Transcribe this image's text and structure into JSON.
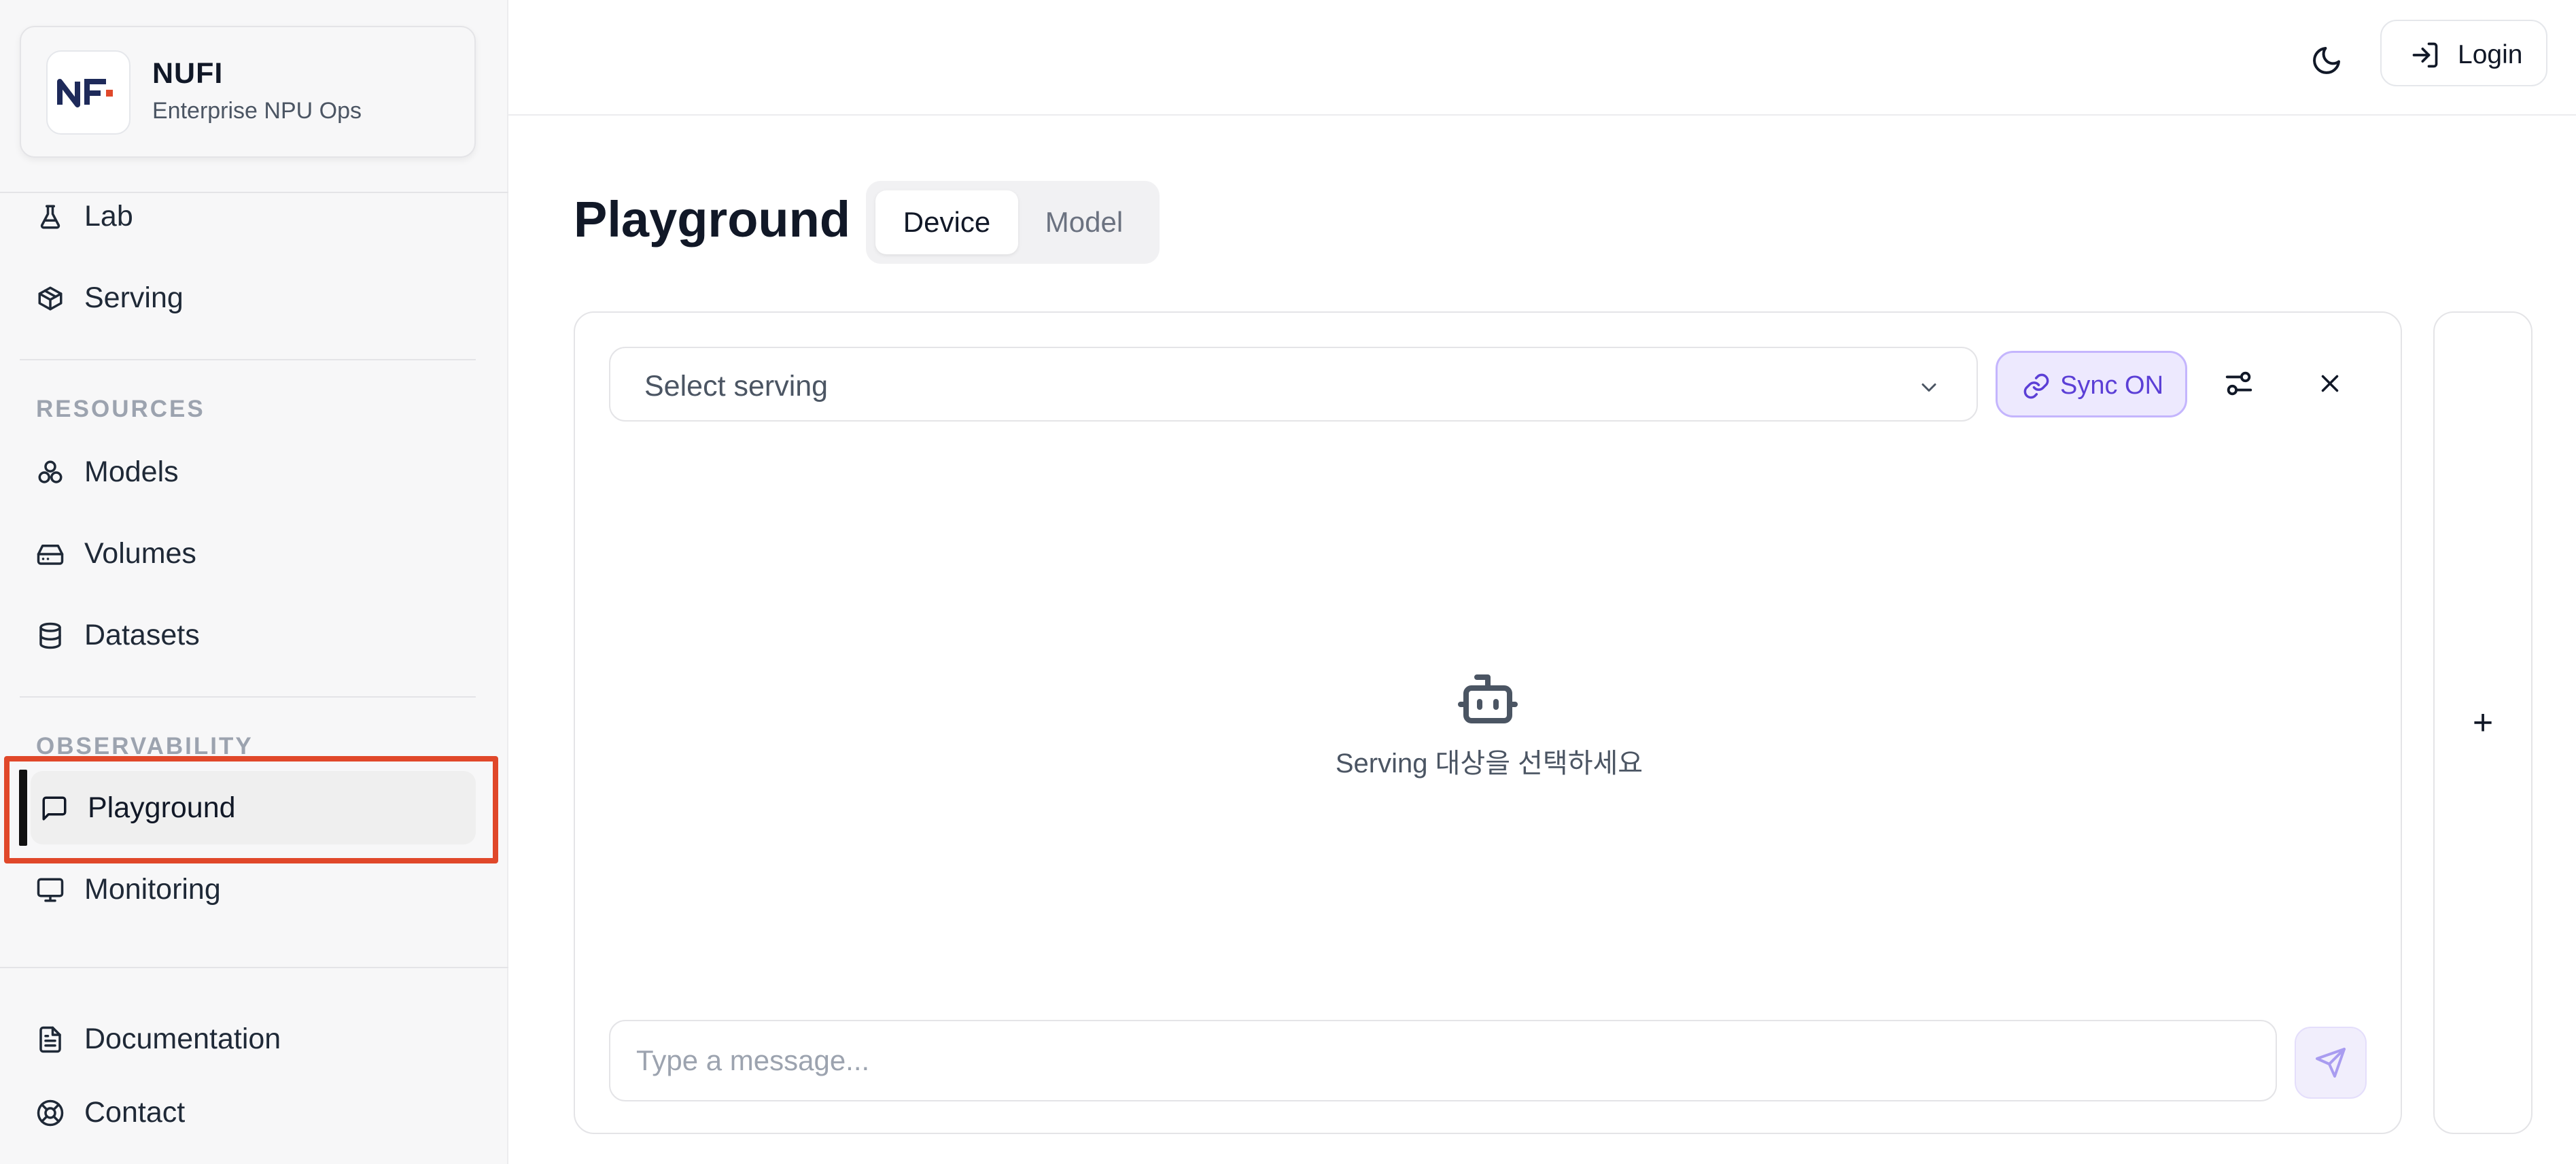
{
  "brand": {
    "name": "NUFI",
    "subtitle": "Enterprise NPU Ops"
  },
  "sidebar": {
    "top_items": [
      {
        "label": "Lab",
        "icon": "flask-icon"
      },
      {
        "label": "Serving",
        "icon": "cube-icon"
      }
    ],
    "resources": {
      "heading": "RESOURCES",
      "items": [
        {
          "label": "Models",
          "icon": "models-icon"
        },
        {
          "label": "Volumes",
          "icon": "hard-drive-icon"
        },
        {
          "label": "Datasets",
          "icon": "database-icon"
        }
      ]
    },
    "observability": {
      "heading": "OBSERVABILITY",
      "items": [
        {
          "label": "Playground",
          "icon": "message-square-icon",
          "active": true
        },
        {
          "label": "Monitoring",
          "icon": "monitor-icon"
        }
      ]
    },
    "bottom_items": [
      {
        "label": "Documentation",
        "icon": "file-text-icon"
      },
      {
        "label": "Contact",
        "icon": "life-buoy-icon"
      }
    ]
  },
  "header": {
    "login_label": "Login"
  },
  "page": {
    "title": "Playground",
    "tabs": [
      {
        "label": "Device",
        "active": true
      },
      {
        "label": "Model",
        "active": false
      }
    ]
  },
  "chat": {
    "select_placeholder": "Select serving",
    "sync_label": "Sync ON",
    "empty_message": "Serving 대상을 선택하세요",
    "input_placeholder": "Type a message..."
  },
  "add_panel": {
    "label": "+"
  },
  "colors": {
    "accent": "#5b3fd6",
    "accent_bg": "#ede9fe",
    "highlight": "#e0482a",
    "logo_navy": "#1e2a5a",
    "logo_red": "#e0482a"
  }
}
